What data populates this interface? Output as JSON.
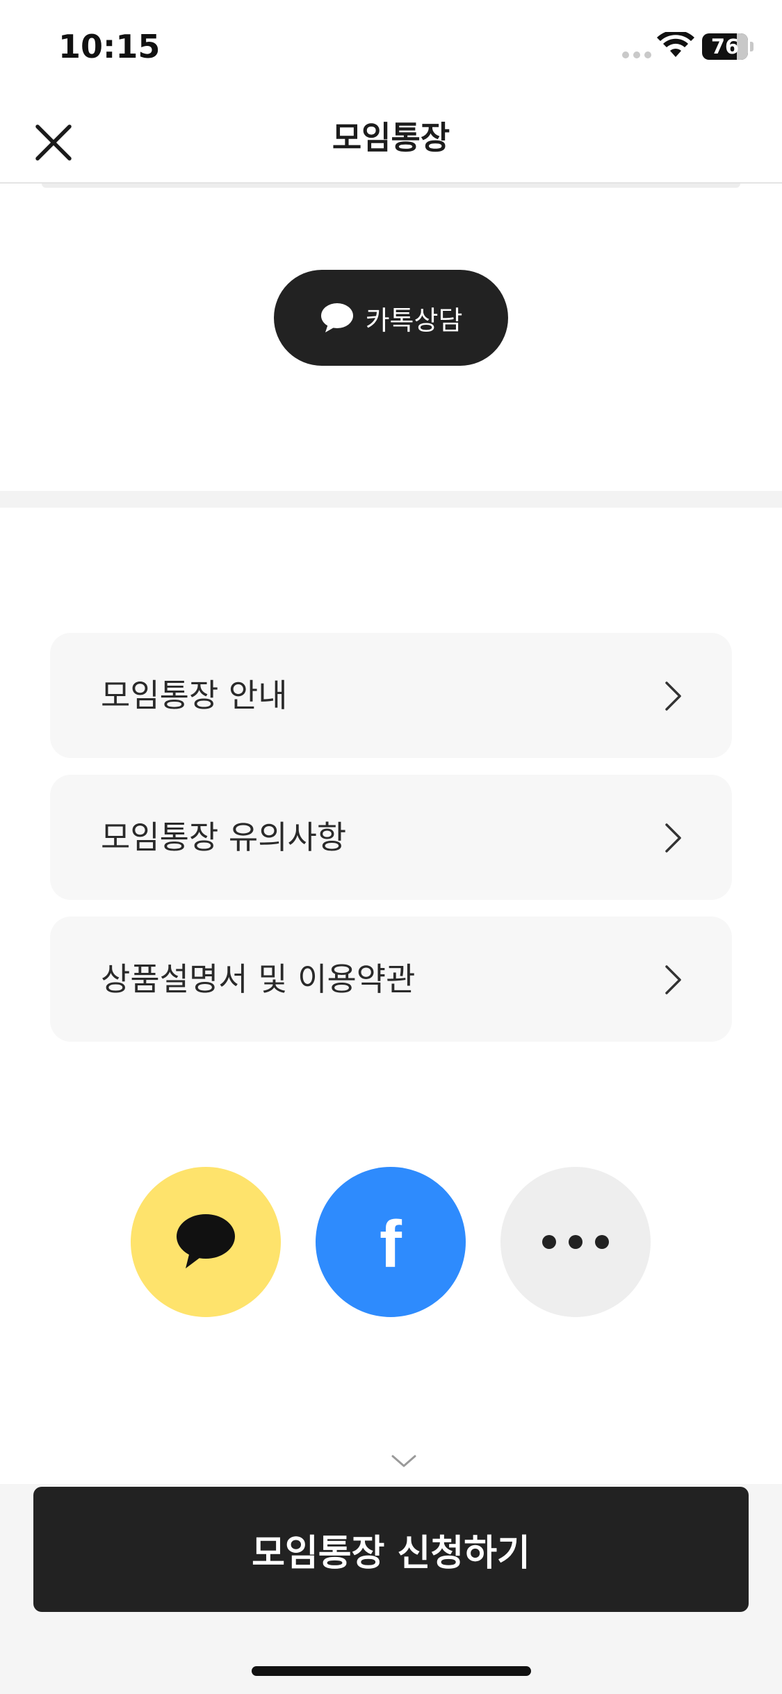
{
  "status_bar": {
    "time": "10:15",
    "battery_percent": "76",
    "battery_level": 0.76
  },
  "nav": {
    "title": "모임통장",
    "close_icon": "close-icon"
  },
  "consult": {
    "label": "카톡상담",
    "icon": "chat-bubble-icon"
  },
  "menu": {
    "items": [
      {
        "label": "모임통장 안내"
      },
      {
        "label": "모임통장 유의사항"
      },
      {
        "label": "상품설명서 및 이용약관"
      }
    ],
    "chevron_icon": "chevron-right-icon"
  },
  "share": {
    "kakao_icon": "kakaotalk-icon",
    "facebook_icon": "facebook-icon",
    "facebook_glyph": "f",
    "more_icon": "more-icon"
  },
  "cta": {
    "label": "모임통장 신청하기"
  },
  "colors": {
    "dark_button": "#222222",
    "kakao_yellow": "#fee36c",
    "facebook_blue": "#2e8bfd",
    "more_gray": "#eeeeee",
    "menu_background": "#f7f7f7"
  }
}
